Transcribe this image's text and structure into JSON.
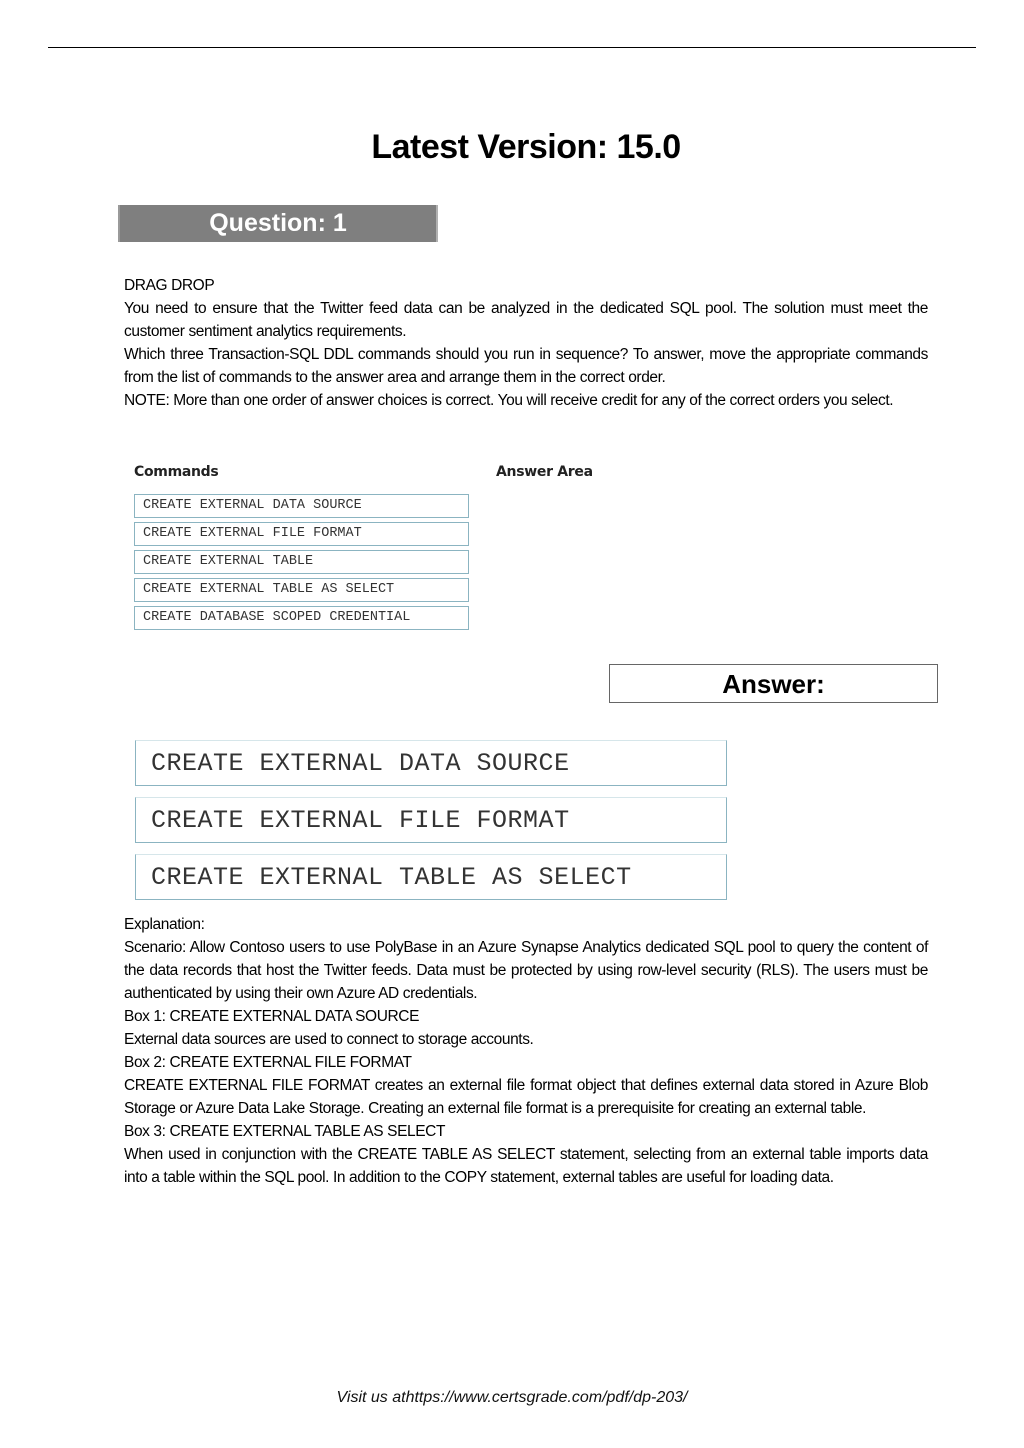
{
  "header": {
    "version_title": "Latest Version: 15.0",
    "question_label": "Question: 1"
  },
  "question": {
    "type": "DRAG DROP",
    "paragraphs": [
      "You need to ensure that the Twitter feed data can be analyzed in the dedicated SQL pool. The solution must meet the customer sentiment analytics requirements.",
      "Which three Transaction-SQL DDL commands should you run in sequence? To answer, move the appropriate commands from the list of commands to the answer area and arrange them in the correct order.",
      "NOTE: More than one order of answer choices is correct. You will receive credit for any of the correct orders you select."
    ]
  },
  "drag_drop": {
    "commands_heading": "Commands",
    "answer_area_heading": "Answer Area",
    "commands": [
      "CREATE EXTERNAL DATA SOURCE",
      "CREATE EXTERNAL FILE FORMAT",
      "CREATE EXTERNAL TABLE",
      "CREATE EXTERNAL TABLE AS SELECT",
      "CREATE DATABASE SCOPED CREDENTIAL"
    ]
  },
  "answer": {
    "label": "Answer:",
    "items": [
      "CREATE EXTERNAL DATA SOURCE",
      "CREATE EXTERNAL FILE FORMAT",
      "CREATE EXTERNAL TABLE AS SELECT"
    ]
  },
  "explanation": {
    "lines": [
      "Explanation:",
      "Scenario: Allow Contoso users to use PolyBase in an Azure Synapse Analytics dedicated SQL pool to query the content of the data records that host the Twitter feeds. Data must be protected by using row-level security (RLS). The users must be authenticated by using their own Azure AD credentials.",
      "Box 1: CREATE EXTERNAL DATA SOURCE",
      "External data sources are used to connect to storage accounts.",
      "Box 2: CREATE EXTERNAL FILE FORMAT",
      "CREATE EXTERNAL FILE FORMAT creates an external file format object that defines external data stored in Azure Blob Storage or Azure Data Lake Storage. Creating an external file format is a prerequisite for creating an external table.",
      "Box 3: CREATE EXTERNAL TABLE AS SELECT",
      "When used in conjunction with the CREATE TABLE AS SELECT statement, selecting from an external table imports data into a table within the SQL pool. In addition to the COPY statement, external tables are useful for loading data."
    ]
  },
  "footer": {
    "text": "Visit us athttps://www.certsgrade.com/pdf/dp-203/"
  }
}
